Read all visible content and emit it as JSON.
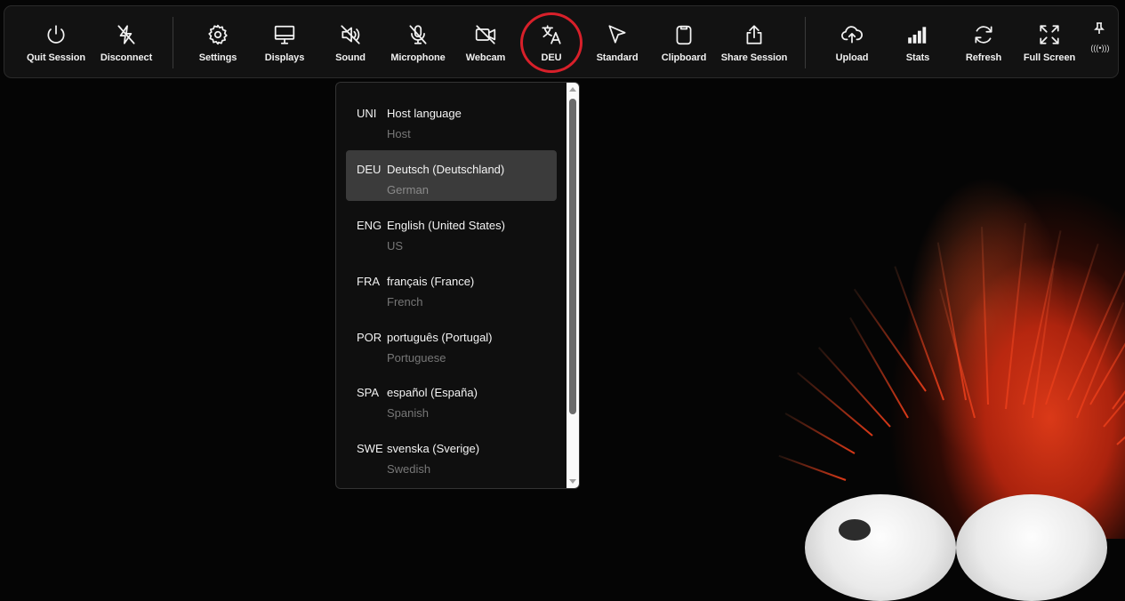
{
  "toolbar": {
    "items": [
      {
        "label": "Quit Session",
        "icon": "power-icon"
      },
      {
        "label": "Disconnect",
        "icon": "disconnect-bolt-icon"
      },
      {
        "label": "Settings",
        "icon": "gear-icon"
      },
      {
        "label": "Displays",
        "icon": "monitor-icon"
      },
      {
        "label": "Sound",
        "icon": "speaker-muted-icon"
      },
      {
        "label": "Microphone",
        "icon": "microphone-muted-icon"
      },
      {
        "label": "Webcam",
        "icon": "webcam-off-icon"
      },
      {
        "label": "DEU",
        "icon": "translate-icon"
      },
      {
        "label": "Standard",
        "icon": "cursor-icon"
      },
      {
        "label": "Clipboard",
        "icon": "clipboard-icon"
      },
      {
        "label": "Share Session",
        "icon": "share-icon"
      },
      {
        "label": "Upload",
        "icon": "cloud-upload-icon"
      },
      {
        "label": "Stats",
        "icon": "signal-bars-icon"
      },
      {
        "label": "Refresh",
        "icon": "refresh-icon"
      },
      {
        "label": "Full Screen",
        "icon": "fullscreen-icon"
      }
    ],
    "pin_icon": "pin-icon",
    "pin_small": "(((•)))",
    "highlight_color": "#d8202a"
  },
  "language_menu": {
    "selected": "DEU",
    "items": [
      {
        "code": "UNI",
        "name": "Host language",
        "sub": "Host"
      },
      {
        "code": "DEU",
        "name": "Deutsch (Deutschland)",
        "sub": "German"
      },
      {
        "code": "ENG",
        "name": "English (United States)",
        "sub": "US"
      },
      {
        "code": "FRA",
        "name": "français (France)",
        "sub": "French"
      },
      {
        "code": "POR",
        "name": "português (Portugal)",
        "sub": "Portuguese"
      },
      {
        "code": "SPA",
        "name": "español (España)",
        "sub": "Spanish"
      },
      {
        "code": "SWE",
        "name": "svenska (Sverige)",
        "sub": "Swedish"
      }
    ]
  }
}
